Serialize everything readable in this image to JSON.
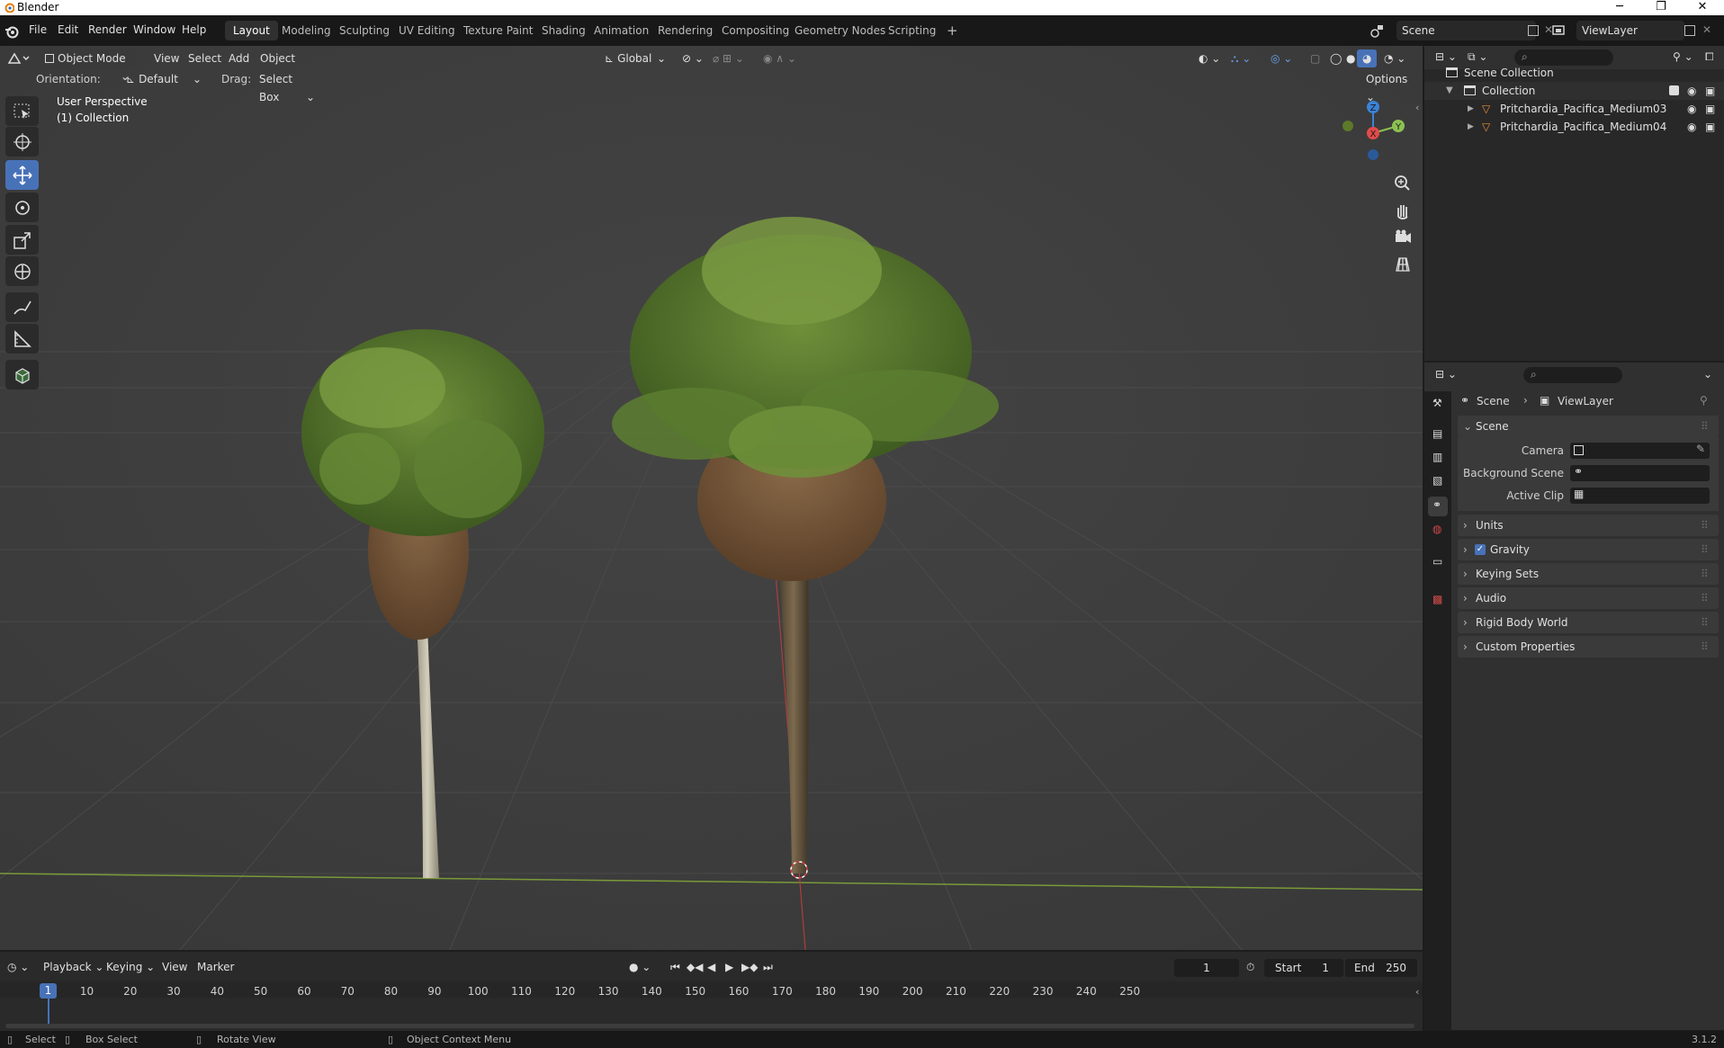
{
  "window": {
    "title": "Blender",
    "minimize": "─",
    "maximize": "❐",
    "close": "✕"
  },
  "menu": {
    "file": "File",
    "edit": "Edit",
    "render": "Render",
    "window": "Window",
    "help": "Help"
  },
  "workspaces": [
    "Layout",
    "Modeling",
    "Sculpting",
    "UV Editing",
    "Texture Paint",
    "Shading",
    "Animation",
    "Rendering",
    "Compositing",
    "Geometry Nodes",
    "Scripting"
  ],
  "add_workspace": "+",
  "scene_selector": {
    "value": "Scene"
  },
  "view_layer_selector": {
    "value": "ViewLayer"
  },
  "viewport": {
    "mode": "Object Mode",
    "menus": {
      "view": "View",
      "select": "Select",
      "add": "Add",
      "object": "Object"
    },
    "transform_orientation": "Global",
    "orientation_label": "Orientation:",
    "orientation_value": "Default",
    "drag_label": "Drag:",
    "drag_value": "Select Box",
    "options": "Options",
    "perspective_text": "User Perspective",
    "collection_text": "(1) Collection",
    "gizmo": {
      "z": "Z",
      "y": "Y",
      "x": "X"
    },
    "colors": {
      "background": "#3d3d3d",
      "x_axis": "#e24a4a",
      "y_axis": "#8cc152",
      "z_axis": "#3b83d8",
      "active_tool": "#4872b8"
    }
  },
  "outliner": {
    "root": "Scene Collection",
    "collection": "Collection",
    "objects": [
      "Pritchardia_Pacifica_Medium03",
      "Pritchardia_Pacifica_Medium04"
    ]
  },
  "properties": {
    "breadcrumb": {
      "scene": "Scene",
      "view_layer": "ViewLayer"
    },
    "scene_panel": {
      "title": "Scene",
      "camera_label": "Camera",
      "background_scene_label": "Background Scene",
      "active_clip_label": "Active Clip"
    },
    "subpanels": [
      "Units",
      "Gravity",
      "Keying Sets",
      "Audio",
      "Rigid Body World",
      "Custom Properties"
    ],
    "gravity_enabled": true
  },
  "timeline": {
    "menus": {
      "playback": "Playback",
      "keying": "Keying",
      "view": "View",
      "marker": "Marker"
    },
    "current_frame": "1",
    "start_label": "Start",
    "start": "1",
    "end_label": "End",
    "end": "250",
    "ticks": [
      "10",
      "20",
      "30",
      "40",
      "50",
      "60",
      "70",
      "80",
      "90",
      "100",
      "110",
      "120",
      "130",
      "140",
      "150",
      "160",
      "170",
      "180",
      "190",
      "200",
      "210",
      "220",
      "230",
      "240",
      "250"
    ],
    "marker_frame": "1"
  },
  "statusbar": {
    "select": "Select",
    "box_select": "Box Select",
    "rotate_view": "Rotate View",
    "context_menu": "Object Context Menu",
    "version": "3.1.2"
  }
}
